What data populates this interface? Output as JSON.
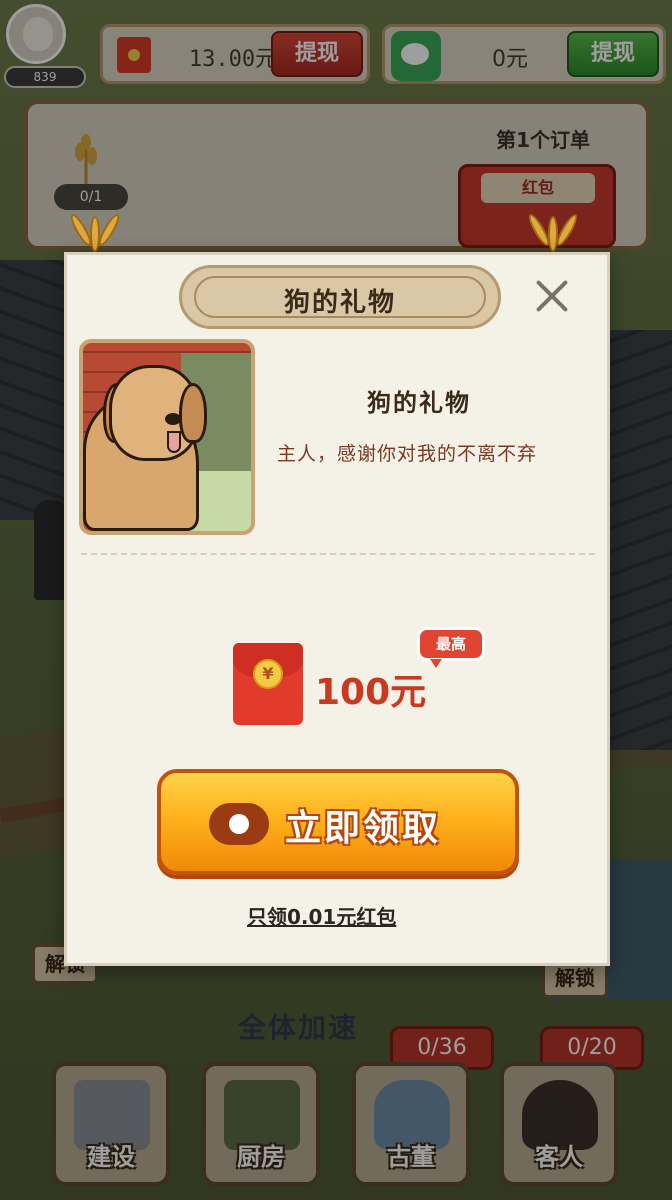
{
  "hud": {
    "level": "839",
    "cash_amount": "13.00元",
    "cash_withdraw_label": "提现",
    "wechat_amount": "0元",
    "wechat_withdraw_label": "提现"
  },
  "order": {
    "title": "第1个订单",
    "progress": "0/1",
    "reward_label": "红包"
  },
  "modal": {
    "title": "狗的礼物",
    "gift_name": "狗的礼物",
    "gift_description": "主人，感谢你对我的不离不弃",
    "reward_amount": "100元",
    "max_tag": "最高",
    "coin_symbol": "¥",
    "claim_label": "立即领取",
    "small_link": "只领0.01元红包"
  },
  "bottom": {
    "speed_label": "全体加速",
    "unlock_left": "解锁",
    "unlock_right": "解锁",
    "counter_antique": "0/36",
    "counter_guest": "0/20",
    "dock": [
      {
        "label": "建设",
        "icon": "build-tools-icon"
      },
      {
        "label": "厨房",
        "icon": "kitchen-pot-icon"
      },
      {
        "label": "古董",
        "icon": "antique-vase-icon"
      },
      {
        "label": "客人",
        "icon": "guest-portrait-icon"
      }
    ]
  },
  "colors": {
    "accent_orange": "#ffb21c",
    "red": "#e23b2c",
    "modal_bg": "#f4f1e7",
    "wechat_green": "#3aa85a"
  }
}
